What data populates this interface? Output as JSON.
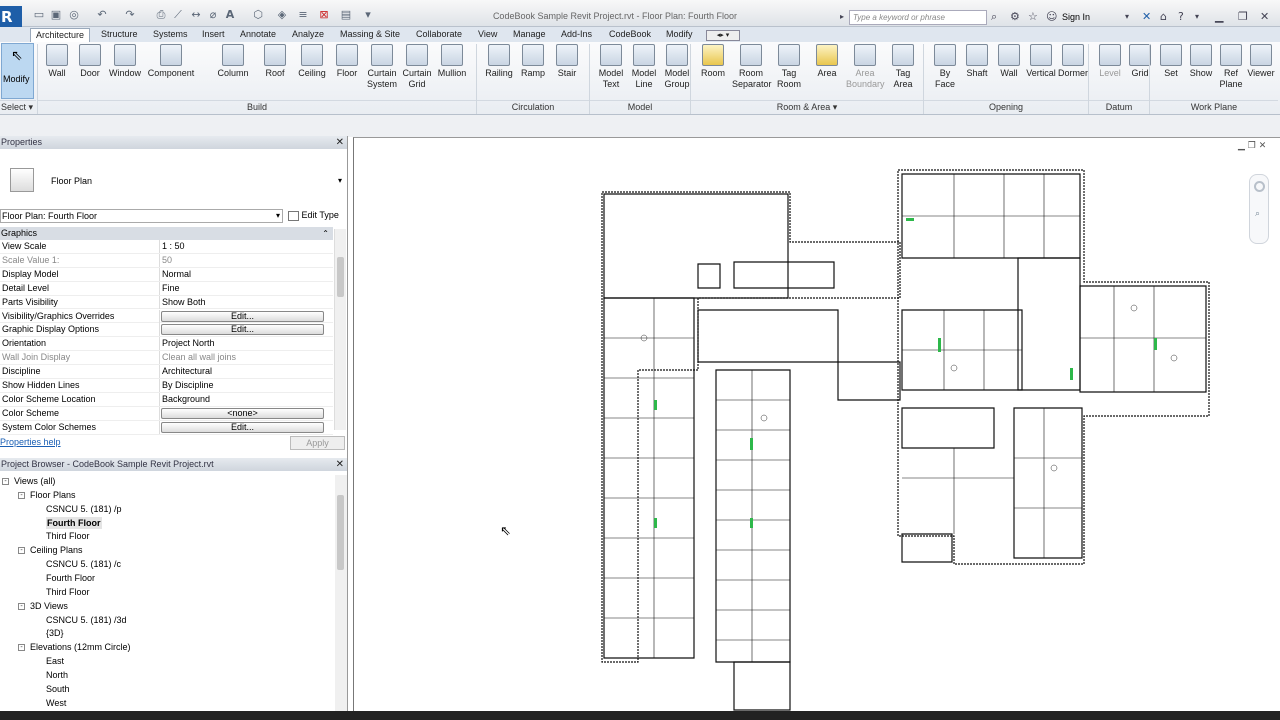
{
  "app": {
    "logo": "R",
    "title": "CodeBook Sample Revit Project.rvt - Floor Plan: Fourth Floor",
    "search_placeholder": "Type a keyword or phrase",
    "sign_in": "Sign In"
  },
  "tabs": [
    "Architecture",
    "Structure",
    "Systems",
    "Insert",
    "Annotate",
    "Analyze",
    "Massing & Site",
    "Collaborate",
    "View",
    "Manage",
    "Add-Ins",
    "CodeBook",
    "Modify"
  ],
  "ribbon": {
    "modify": "Modify",
    "select": "Select",
    "build": [
      {
        "l1": "Wall",
        "l2": ""
      },
      {
        "l1": "Door",
        "l2": ""
      },
      {
        "l1": "Window",
        "l2": ""
      },
      {
        "l1": "Component",
        "l2": ""
      },
      {
        "l1": "Column",
        "l2": ""
      },
      {
        "l1": "Roof",
        "l2": ""
      },
      {
        "l1": "Ceiling",
        "l2": ""
      },
      {
        "l1": "Floor",
        "l2": ""
      },
      {
        "l1": "Curtain",
        "l2": "System"
      },
      {
        "l1": "Curtain",
        "l2": "Grid"
      },
      {
        "l1": "Mullion",
        "l2": ""
      }
    ],
    "circulation": [
      {
        "l1": "Railing",
        "l2": ""
      },
      {
        "l1": "Ramp",
        "l2": ""
      },
      {
        "l1": "Stair",
        "l2": ""
      }
    ],
    "model": [
      {
        "l1": "Model",
        "l2": "Text"
      },
      {
        "l1": "Model",
        "l2": "Line"
      },
      {
        "l1": "Model",
        "l2": "Group"
      }
    ],
    "roomarea": [
      {
        "l1": "Room",
        "l2": ""
      },
      {
        "l1": "Room",
        "l2": "Separator"
      },
      {
        "l1": "Tag",
        "l2": "Room"
      },
      {
        "l1": "Area",
        "l2": ""
      },
      {
        "l1": "Area",
        "l2": "Boundary"
      },
      {
        "l1": "Tag",
        "l2": "Area"
      }
    ],
    "opening": [
      {
        "l1": "By",
        "l2": "Face"
      },
      {
        "l1": "Shaft",
        "l2": ""
      },
      {
        "l1": "Wall",
        "l2": ""
      },
      {
        "l1": "Vertical",
        "l2": ""
      },
      {
        "l1": "Dormer",
        "l2": ""
      }
    ],
    "datum": [
      {
        "l1": "Level",
        "l2": ""
      },
      {
        "l1": "Grid",
        "l2": ""
      }
    ],
    "workplane": [
      {
        "l1": "Set",
        "l2": ""
      },
      {
        "l1": "Show",
        "l2": ""
      },
      {
        "l1": "Ref",
        "l2": "Plane"
      },
      {
        "l1": "Viewer",
        "l2": ""
      }
    ],
    "groups": {
      "build": "Build",
      "circulation": "Circulation",
      "model": "Model",
      "roomarea": "Room & Area",
      "opening": "Opening",
      "datum": "Datum",
      "workplane": "Work Plane"
    }
  },
  "properties": {
    "title": "Properties",
    "type_name": "Floor Plan",
    "selector": "Floor Plan: Fourth Floor",
    "edit_type": "Edit Type",
    "section": "Graphics",
    "rows": [
      {
        "label": "View Scale",
        "value": "1 : 50",
        "kind": "text"
      },
      {
        "label": "Scale Value    1:",
        "value": "50",
        "kind": "gray"
      },
      {
        "label": "Display Model",
        "value": "Normal",
        "kind": "text"
      },
      {
        "label": "Detail Level",
        "value": "Fine",
        "kind": "text"
      },
      {
        "label": "Parts Visibility",
        "value": "Show Both",
        "kind": "text"
      },
      {
        "label": "Visibility/Graphics Overrides",
        "value": "Edit...",
        "kind": "button"
      },
      {
        "label": "Graphic Display Options",
        "value": "Edit...",
        "kind": "button"
      },
      {
        "label": "Orientation",
        "value": "Project North",
        "kind": "text"
      },
      {
        "label": "Wall Join Display",
        "value": "Clean all wall joins",
        "kind": "gray"
      },
      {
        "label": "Discipline",
        "value": "Architectural",
        "kind": "text"
      },
      {
        "label": "Show Hidden Lines",
        "value": "By Discipline",
        "kind": "text"
      },
      {
        "label": "Color Scheme Location",
        "value": "Background",
        "kind": "text"
      },
      {
        "label": "Color Scheme",
        "value": "<none>",
        "kind": "button"
      },
      {
        "label": "System Color Schemes",
        "value": "Edit...",
        "kind": "button"
      }
    ],
    "help": "Properties help",
    "apply": "Apply"
  },
  "browser": {
    "title": "Project Browser - CodeBook Sample Revit Project.rvt",
    "items": [
      {
        "text": "Views (all)",
        "level": 0,
        "exp": "-"
      },
      {
        "text": "Floor Plans",
        "level": 1,
        "exp": "-"
      },
      {
        "text": "CSNCU 5. (181) /p",
        "level": 2,
        "exp": ""
      },
      {
        "text": "Fourth Floor",
        "level": 2,
        "exp": "",
        "bold": true
      },
      {
        "text": "Third Floor",
        "level": 2,
        "exp": ""
      },
      {
        "text": "Ceiling Plans",
        "level": 1,
        "exp": "-"
      },
      {
        "text": "CSNCU 5. (181) /c",
        "level": 2,
        "exp": ""
      },
      {
        "text": "Fourth Floor",
        "level": 2,
        "exp": ""
      },
      {
        "text": "Third Floor",
        "level": 2,
        "exp": ""
      },
      {
        "text": "3D Views",
        "level": 1,
        "exp": "-"
      },
      {
        "text": "CSNCU 5. (181) /3d",
        "level": 2,
        "exp": ""
      },
      {
        "text": "{3D}",
        "level": 2,
        "exp": ""
      },
      {
        "text": "Elevations (12mm Circle)",
        "level": 1,
        "exp": "-"
      },
      {
        "text": "East",
        "level": 2,
        "exp": ""
      },
      {
        "text": "North",
        "level": 2,
        "exp": ""
      },
      {
        "text": "South",
        "level": 2,
        "exp": ""
      },
      {
        "text": "West",
        "level": 2,
        "exp": ""
      }
    ]
  },
  "colors": {
    "accent": "#1e5ea8",
    "room_green": "#2db84a",
    "wall": "#111111"
  }
}
